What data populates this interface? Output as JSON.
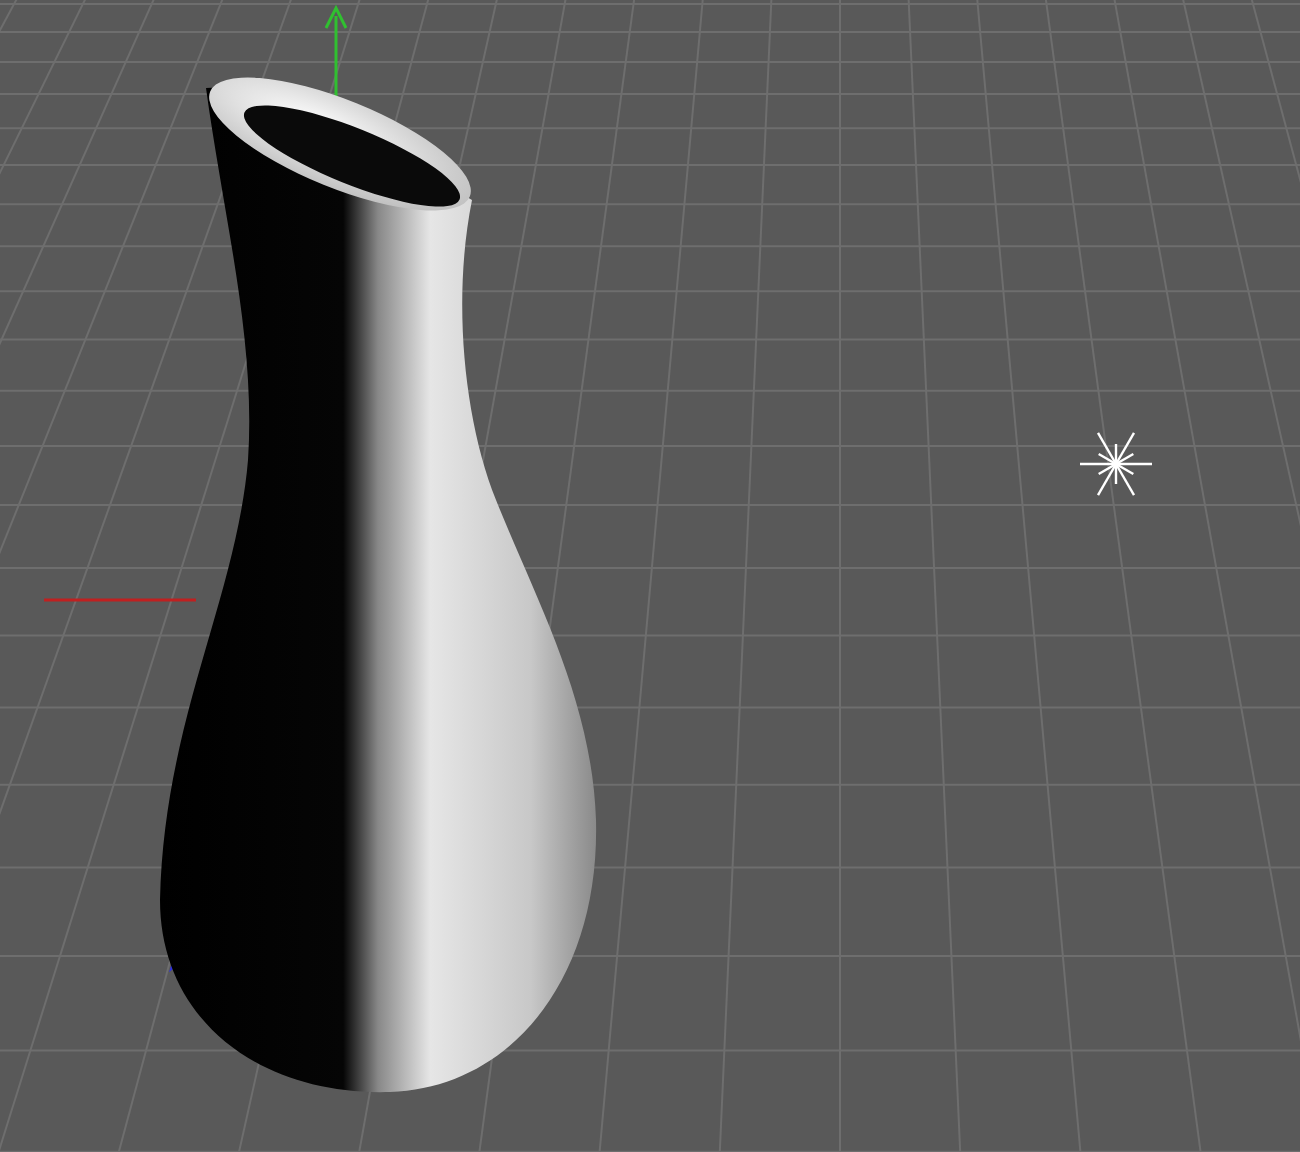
{
  "viewport": {
    "show_grid": true,
    "show_axes": true,
    "show_light": true,
    "show_object": true
  }
}
